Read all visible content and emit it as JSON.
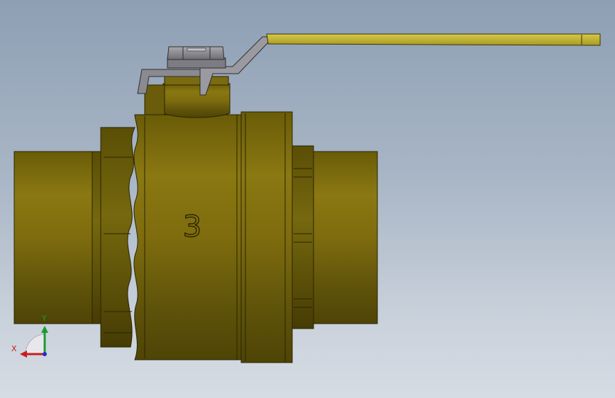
{
  "part_marking": "3",
  "triad": {
    "x_label": "X",
    "y_label": "Y",
    "x_color": "#c81e1e",
    "y_color": "#1e9a2e",
    "z_color": "#2030c8"
  },
  "colors": {
    "body_brass": "#7a6a10",
    "handle_yellow": "#c8bc3a",
    "stem_nut_gray": "#8e8e94",
    "background_top": "#8e9fb4",
    "background_bottom": "#d6dce4"
  }
}
